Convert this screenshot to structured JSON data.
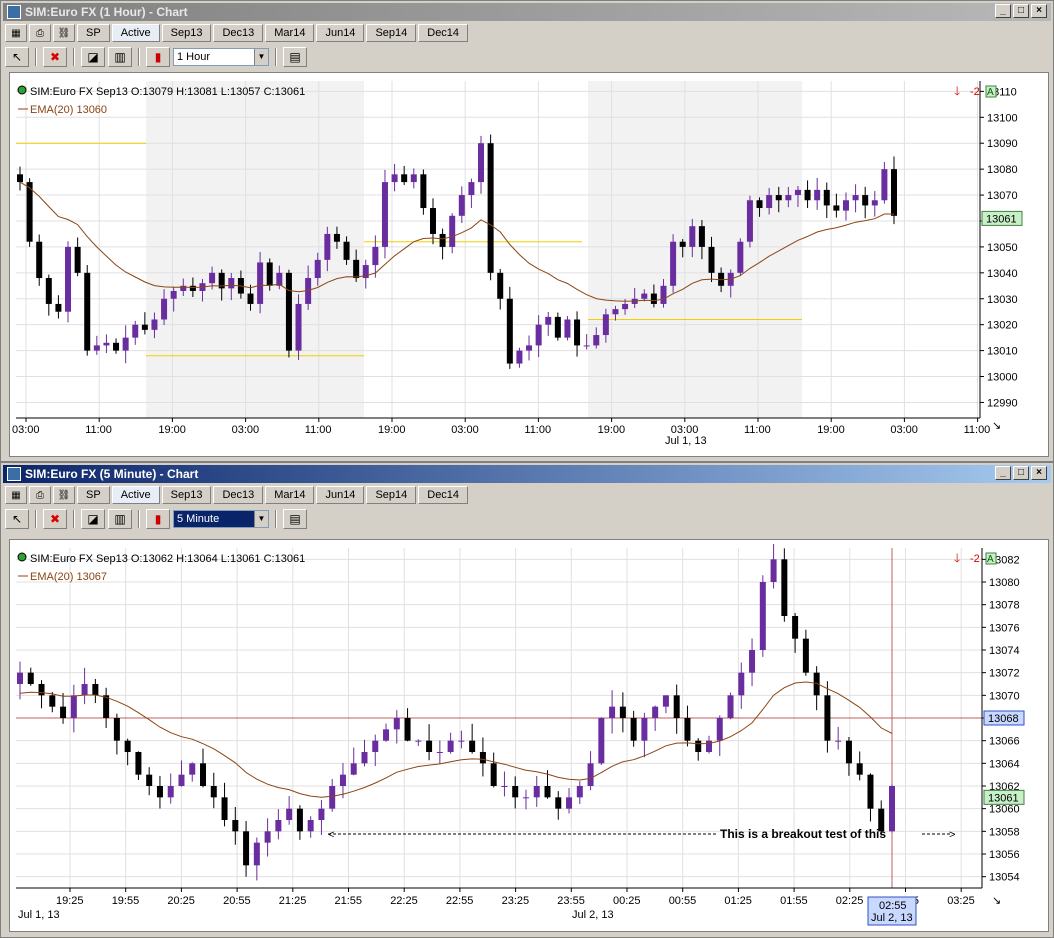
{
  "window1": {
    "title": "SIM:Euro FX (1 Hour) - Chart",
    "tabs": [
      "Active",
      "Sep13",
      "Dec13",
      "Mar14",
      "Jun14",
      "Sep14",
      "Dec14"
    ],
    "sp_label": "SP",
    "interval": "1 Hour",
    "info_line": "SIM:Euro FX Sep13 O:13079 H:13081 L:13057 C:13061",
    "ema_line": "EMA(20)  13060",
    "position_badge": "-2",
    "price_tag": "13061",
    "y_ticks": [
      "13110",
      "13100",
      "13090",
      "13080",
      "13070",
      "13060",
      "13050",
      "13040",
      "13030",
      "13020",
      "13010",
      "13000",
      "12990"
    ],
    "x_ticks": [
      "03:00",
      "11:00",
      "19:00",
      "03:00",
      "11:00",
      "19:00",
      "03:00",
      "11:00",
      "19:00",
      "03:00",
      "11:00",
      "19:00",
      "03:00",
      "11:00"
    ],
    "date_label": "Jul 1, 13"
  },
  "window2": {
    "title": "SIM:Euro FX (5 Minute) - Chart",
    "tabs": [
      "Active",
      "Sep13",
      "Dec13",
      "Mar14",
      "Jun14",
      "Sep14",
      "Dec14"
    ],
    "sp_label": "SP",
    "interval": "5 Minute",
    "info_line": "SIM:Euro FX Sep13 O:13062 H:13064 L:13061 C:13061",
    "ema_line": "EMA(20)  13067",
    "position_badge": "-2",
    "price_tag": "13061",
    "line_tag": "13068",
    "annotation": "This is a breakout test of this",
    "y_ticks": [
      "13082",
      "13080",
      "13078",
      "13076",
      "13074",
      "13072",
      "13070",
      "13068",
      "13066",
      "13064",
      "13062",
      "13060",
      "13058",
      "13056",
      "13054"
    ],
    "x_ticks": [
      "19:25",
      "19:55",
      "20:25",
      "20:55",
      "21:25",
      "21:55",
      "22:25",
      "22:55",
      "23:25",
      "23:55",
      "00:25",
      "00:55",
      "01:25",
      "01:55",
      "02:25",
      "02:55",
      "03:25"
    ],
    "date_label_left": "Jul 1, 13",
    "date_label_mid": "Jul 2, 13",
    "cursor_time": "02:55",
    "cursor_date": "Jul 2, 13"
  },
  "colors": {
    "bull": "#6a2d9f",
    "bear": "#000000",
    "ema": "#8b4513",
    "line_yellow": "#f0d000",
    "line_red": "#c06060",
    "tag_green": "#c8f0c8",
    "tag_blue": "#c8d8ff"
  },
  "chart_data": [
    {
      "type": "candlestick",
      "title": "SIM:Euro FX (1 Hour) - Chart",
      "ylim": [
        12984,
        13114
      ],
      "x_tick_labels": [
        "03:00",
        "11:00",
        "19:00",
        "03:00",
        "11:00",
        "19:00",
        "03:00",
        "11:00",
        "19:00",
        "03:00",
        "11:00",
        "19:00",
        "03:00",
        "11:00"
      ],
      "candles_close": [
        13075,
        13052,
        13038,
        13028,
        13025,
        13050,
        13040,
        13010,
        13012,
        13013,
        13010,
        13015,
        13020,
        13018,
        13022,
        13030,
        13033,
        13035,
        13033,
        13036,
        13040,
        13034,
        13038,
        13032,
        13028,
        13044,
        13035,
        13040,
        13010,
        13028,
        13038,
        13045,
        13055,
        13052,
        13045,
        13038,
        13043,
        13050,
        13075,
        13078,
        13075,
        13078,
        13065,
        13055,
        13050,
        13062,
        13070,
        13075,
        13090,
        13040,
        13030,
        13005,
        13010,
        13012,
        13020,
        13023,
        13015,
        13022,
        13012,
        13012,
        13016,
        13024,
        13026,
        13028,
        13030,
        13032,
        13028,
        13035,
        13052,
        13050,
        13058,
        13050,
        13040,
        13035,
        13040,
        13052,
        13068,
        13065,
        13070,
        13068,
        13070,
        13072,
        13068,
        13072,
        13066,
        13064,
        13068,
        13070,
        13066,
        13068,
        13080,
        13062
      ],
      "ema_last": 13060,
      "last": {
        "open": 13079,
        "high": 13081,
        "low": 13057,
        "close": 13061
      }
    },
    {
      "type": "candlestick",
      "title": "SIM:Euro FX (5 Minute) - Chart",
      "ylim": [
        13053,
        13083
      ],
      "x_tick_labels": [
        "19:25",
        "19:55",
        "20:25",
        "20:55",
        "21:25",
        "21:55",
        "22:25",
        "22:55",
        "23:25",
        "23:55",
        "00:25",
        "00:55",
        "01:25",
        "01:55",
        "02:25",
        "02:55",
        "03:25"
      ],
      "horizontal_line": 13068,
      "ema_last": 13067,
      "last": {
        "open": 13062,
        "high": 13064,
        "low": 13061,
        "close": 13061
      }
    }
  ]
}
